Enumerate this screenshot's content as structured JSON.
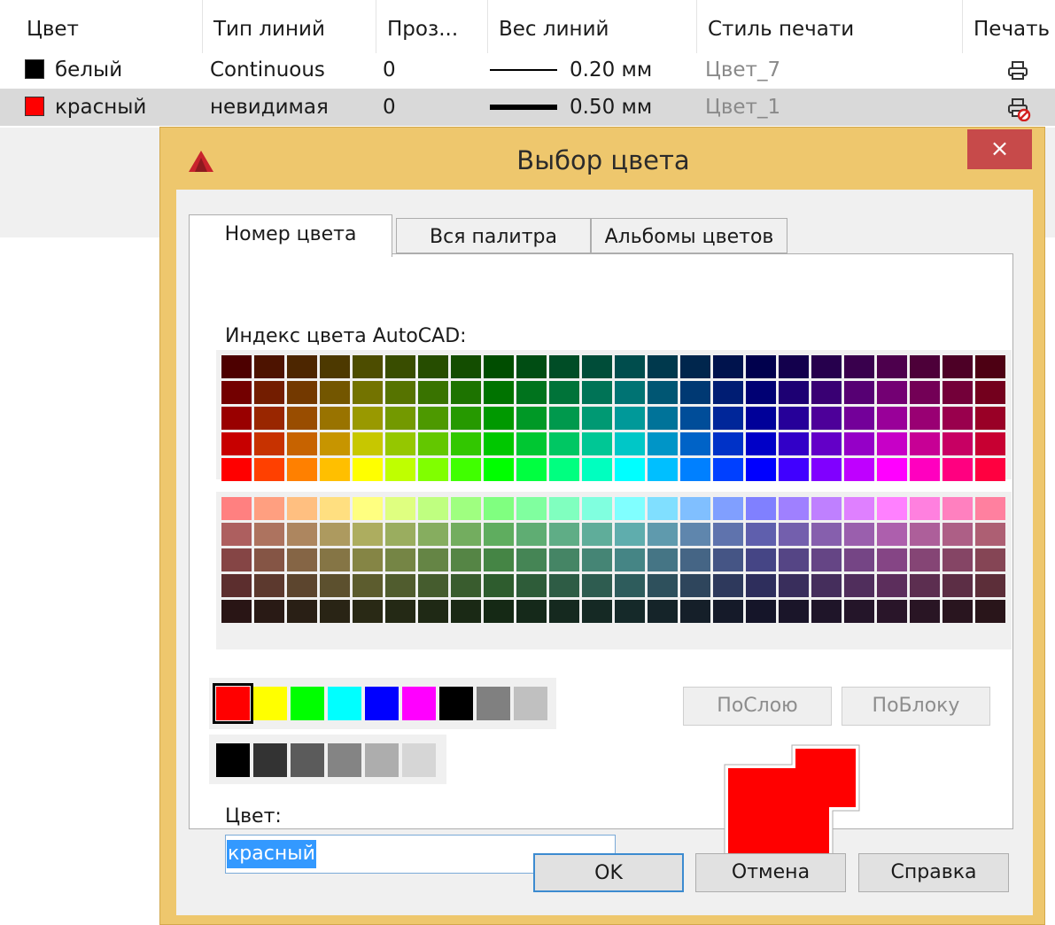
{
  "layer_table": {
    "columns": [
      "Цвет",
      "Тип линий",
      "Проз...",
      "Вес линий",
      "Стиль печати",
      "Печать"
    ],
    "rows": [
      {
        "color_name": "белый",
        "swatch": "#000000",
        "linetype": "Continuous",
        "transparency": "0",
        "lineweight": "0.20 мм",
        "plot_style": "Цвет_7",
        "selected": false
      },
      {
        "color_name": "красный",
        "swatch": "#ff0000",
        "linetype": "невидимая",
        "transparency": "0",
        "lineweight": "0.50 мм",
        "plot_style": "Цвет_1",
        "selected": true
      }
    ]
  },
  "dialog": {
    "title": "Выбор цвета",
    "close_glyph": "×",
    "tabs": [
      "Номер цвета",
      "Вся палитра",
      "Альбомы цветов"
    ],
    "active_tab": 0,
    "aci_label": "Индекс цвета AutoCAD:",
    "bylayer_label": "ПоСлою",
    "byblock_label": "ПоБлоку",
    "color_field_label": "Цвет:",
    "color_value": "красный",
    "ok_label": "OK",
    "cancel_label": "Отмена",
    "help_label": "Справка",
    "standard_colors": [
      "#ff0000",
      "#ffff00",
      "#00ff00",
      "#00ffff",
      "#0000ff",
      "#ff00ff",
      "#000000",
      "#808080",
      "#c0c0c0"
    ],
    "gray_colors": [
      "#000000",
      "#333333",
      "#5b5b5b",
      "#848484",
      "#adadad",
      "#d6d6d6"
    ],
    "selected_color": "#ff0000"
  }
}
